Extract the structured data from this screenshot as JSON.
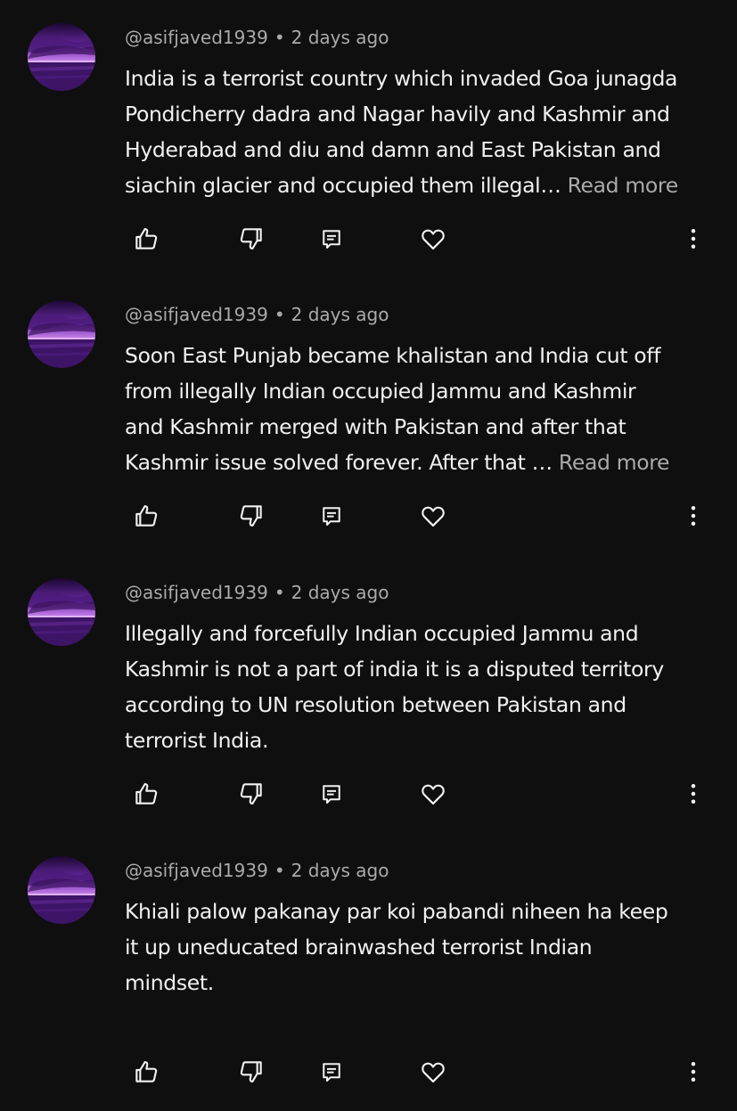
{
  "comments": [
    {
      "author": "@asifjaved1939",
      "separator": "•",
      "time": "2 days ago",
      "lines": [
        "India is a terrorist country which invaded Goa junagda",
        "Pondicherry dadra and Nagar havily and Kashmir and",
        "Hyderabad and diu and damn and East Pakistan and",
        "siachin glacier and occupied them illegal… "
      ],
      "read_more": "Read more",
      "avatar_icon": "purple-sunset-avatar"
    },
    {
      "author": "@asifjaved1939",
      "separator": "•",
      "time": "2 days ago",
      "lines": [
        "Soon East Punjab became khalistan and India cut off",
        "from illegally Indian occupied Jammu and Kashmir",
        "and Kashmir merged with Pakistan and after that",
        "Kashmir issue solved forever. After that … "
      ],
      "read_more": "Read more",
      "avatar_icon": "purple-sunset-avatar"
    },
    {
      "author": "@asifjaved1939",
      "separator": "•",
      "time": "2 days ago",
      "lines": [
        "Illegally and forcefully Indian occupied Jammu and",
        "Kashmir is not a part of india it is a disputed territory",
        "according to UN resolution between Pakistan and",
        "terrorist India."
      ],
      "read_more": "",
      "avatar_icon": "purple-sunset-avatar"
    },
    {
      "author": "@asifjaved1939",
      "separator": "•",
      "time": "2 days ago",
      "lines": [
        "Khiali palow pakanay par koi pabandi niheen ha keep",
        "it up uneducated brainwashed terrorist Indian",
        "mindset.",
        ""
      ],
      "read_more": "",
      "avatar_icon": "purple-sunset-avatar"
    }
  ],
  "action_icons": [
    "like-icon",
    "dislike-icon",
    "reply-icon",
    "heart-icon",
    "more-options-icon"
  ],
  "colors": {
    "background": "#0f0f0f",
    "text": "#f1f1f1",
    "secondary_text": "#aaaaaa",
    "icon": "#f1f1f1"
  }
}
